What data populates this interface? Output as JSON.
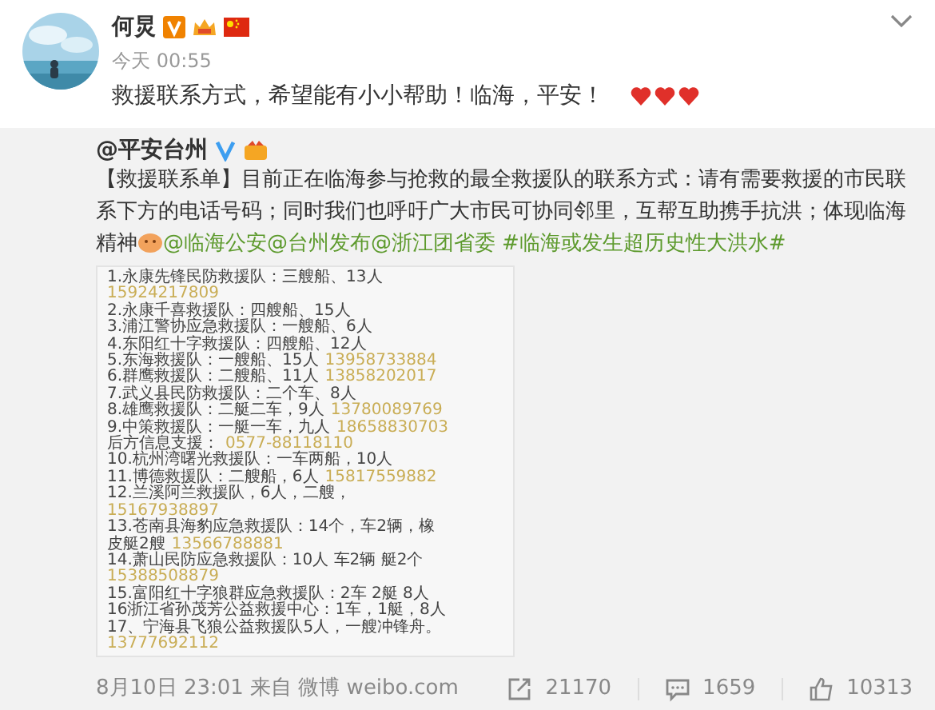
{
  "post": {
    "author": "何炅",
    "time": "今天 00:55",
    "text": "救援联系方式，希望能有小小帮助！临海，平安！"
  },
  "repost": {
    "author": "@平安台州",
    "segments": [
      {
        "kind": "text",
        "text": "【救援联系单】目前正在临海参与抢救的最全救援队的联系方式：请有需要救援的市民联系下方的电话号码；同时我们也呼吁广大市民可协同邻里，互帮互助携手抗洪；体现临海精神"
      },
      {
        "kind": "emoji"
      },
      {
        "kind": "link",
        "text": "@临海公安"
      },
      {
        "kind": "link",
        "text": "@台州发布"
      },
      {
        "kind": "link",
        "text": "@浙江团省委"
      },
      {
        "kind": "hashtag",
        "text": "#临海或发生超历史性大洪水#"
      }
    ],
    "image_lines": [
      {
        "text": "1.永康先锋民防救援队：三艘船、13人"
      },
      {
        "phone": "15924217809"
      },
      {
        "text": "2.永康千喜救援队：四艘船、15人"
      },
      {
        "text": "3.浦江警协应急救援队：一艘船、6人"
      },
      {
        "text": "4.东阳红十字救援队：四艘船、12人"
      },
      {
        "text": "5.东海救援队：一艘船、15人",
        "phone": "13958733884"
      },
      {
        "text": "6.群鹰救援队：二艘船、11人",
        "phone": "13858202017"
      },
      {
        "text": "7.武义县民防救援队：二个车、8人"
      },
      {
        "text": "8.雄鹰救援队：二艇二车，9人",
        "phone": "13780089769"
      },
      {
        "text": "9.中策救援队：一艇一车，九人",
        "phone": "18658830703"
      },
      {
        "text": "后方信息支援：",
        "phone": "0577-88118110"
      },
      {
        "text": "10.杭州湾曙光救援队：一车两船，10人"
      },
      {
        "text": "11.博德救援队：二艘船，6人",
        "phone": "15817559882"
      },
      {
        "text": "12.兰溪阿兰救援队，6人，二艘，"
      },
      {
        "phone": "15167938897"
      },
      {
        "text": "13.苍南县海豹应急救援队：14个，车2辆，橡"
      },
      {
        "text": "皮艇2艘",
        "phone": "13566788881"
      },
      {
        "text": "14.萧山民防应急救援队：10人 车2辆 艇2个"
      },
      {
        "phone": "15388508879"
      },
      {
        "text": "15.富阳红十字狼群应急救援队：2车 2艇 8人"
      },
      {
        "text": "16浙江省孙茂芳公益救援中心：1车，1艇，8人"
      },
      {
        "text": "17、宁海县飞狼公益救援队5人，一艘冲锋舟。"
      },
      {
        "phone": "13777692112"
      }
    ]
  },
  "footer": {
    "meta": "8月10日 23:01 来自 微博 weibo.com",
    "actions": [
      {
        "kind": "share",
        "count": "21170"
      },
      {
        "kind": "comment",
        "count": "1659"
      },
      {
        "kind": "like",
        "count": "10313"
      }
    ]
  }
}
